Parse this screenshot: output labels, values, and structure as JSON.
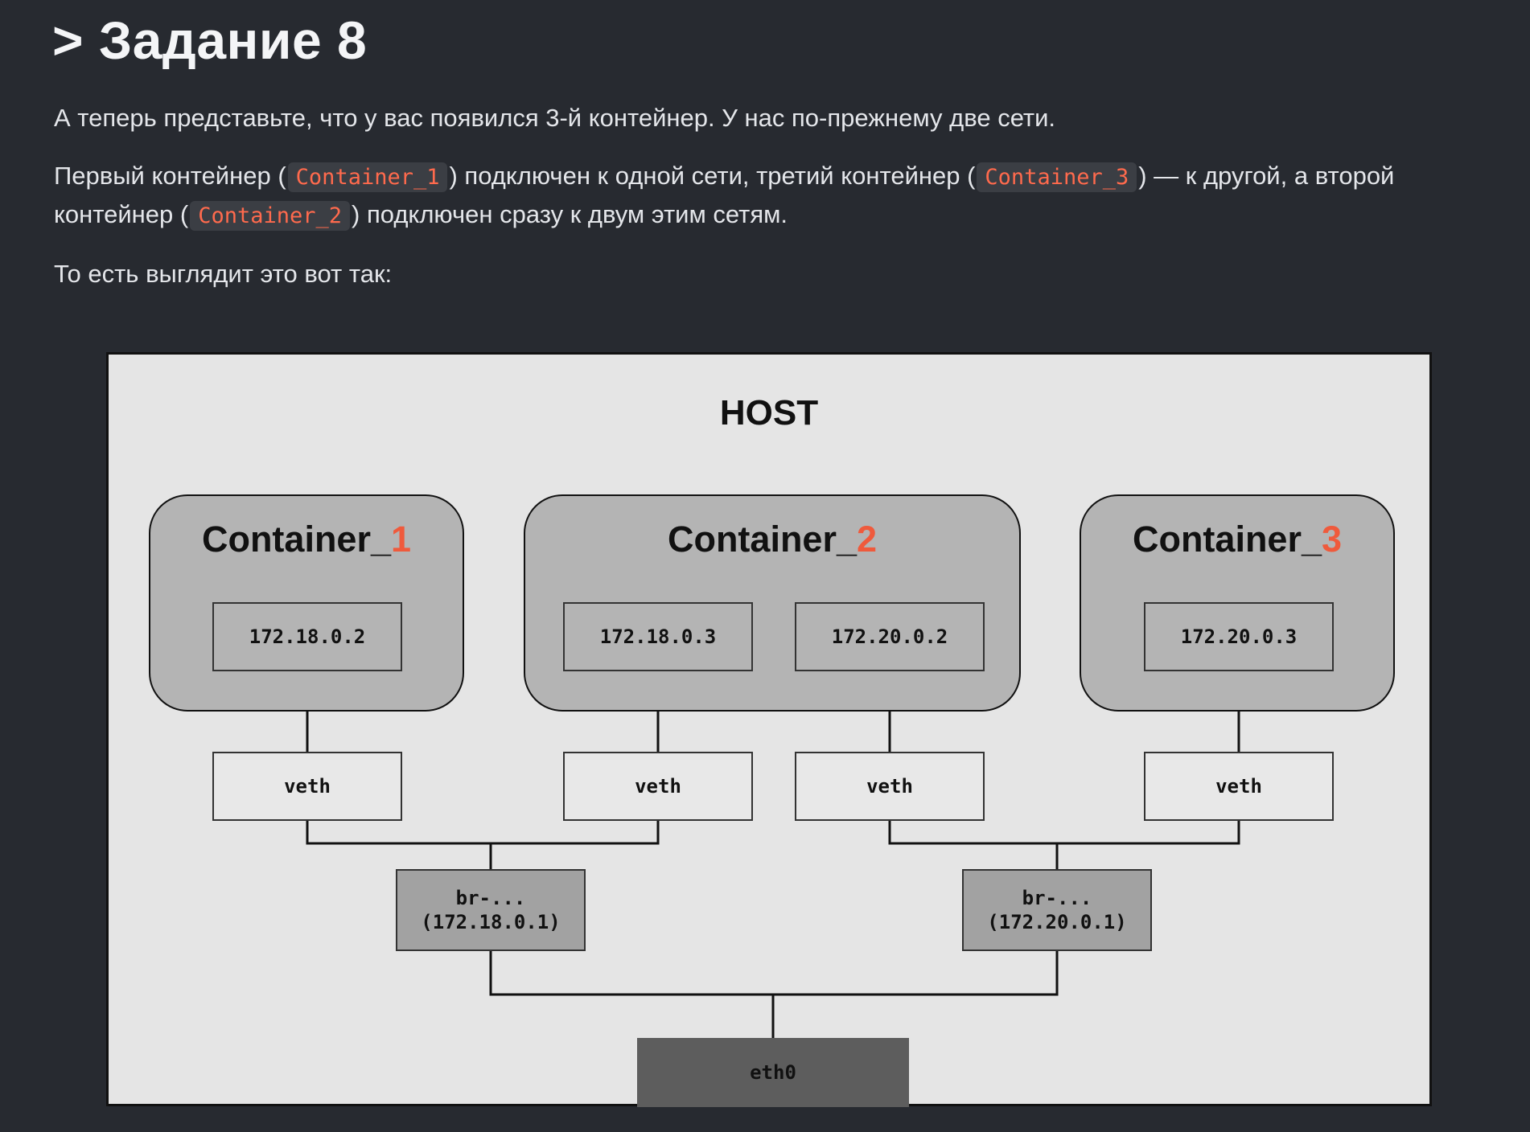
{
  "page": {
    "title": "> Задание 8",
    "p1": "А теперь представьте, что у вас появился 3-й контейнер.  У нас по-прежнему две сети.",
    "p2": {
      "t1": "Первый контейнер (",
      "c1": "Container_1",
      "t2": ") подключен к одной сети, третий контейнер (",
      "c3": "Container_3",
      "t3": ") — к другой, а второй контейнер (",
      "c2": "Container_2",
      "t4": ") подключен сразу к двум этим сетям."
    },
    "p3": "То есть выглядит это вот так:"
  },
  "diagram": {
    "host_label": "HOST",
    "containers": [
      {
        "prefix": "Container_",
        "num": "1",
        "ips": [
          "172.18.0.2"
        ]
      },
      {
        "prefix": "Container_",
        "num": "2",
        "ips": [
          "172.18.0.3",
          "172.20.0.2"
        ]
      },
      {
        "prefix": "Container_",
        "num": "3",
        "ips": [
          "172.20.0.3"
        ]
      }
    ],
    "veth_label": "veth",
    "bridges": [
      {
        "name": "br-...",
        "ip": "(172.18.0.1)"
      },
      {
        "name": "br-...",
        "ip": "(172.20.0.1)"
      }
    ],
    "eth0_label": "eth0",
    "colors": {
      "accent": "#ef5a3c",
      "code_text": "#ff6a4d",
      "background": "#272a30"
    }
  }
}
